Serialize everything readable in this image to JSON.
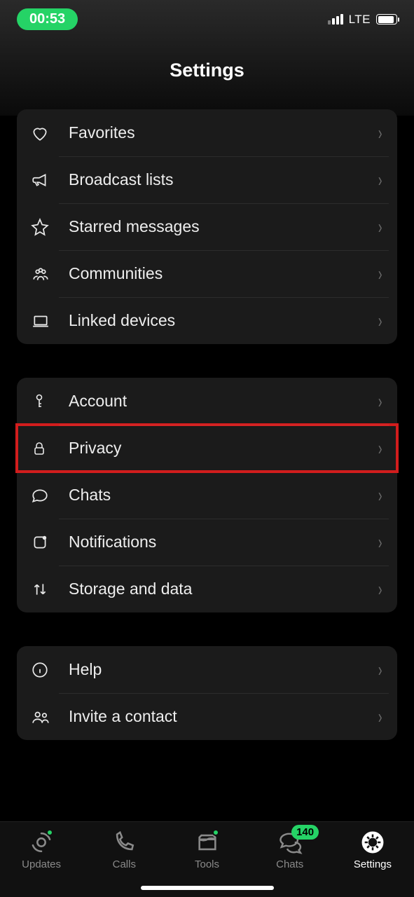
{
  "status": {
    "time": "00:53",
    "network": "LTE"
  },
  "page_title": "Settings",
  "groups": [
    {
      "rows": [
        {
          "key": "favorites",
          "label": "Favorites"
        },
        {
          "key": "broadcast",
          "label": "Broadcast lists"
        },
        {
          "key": "starred",
          "label": "Starred messages"
        },
        {
          "key": "communities",
          "label": "Communities"
        },
        {
          "key": "linked",
          "label": "Linked devices"
        }
      ]
    },
    {
      "rows": [
        {
          "key": "account",
          "label": "Account"
        },
        {
          "key": "privacy",
          "label": "Privacy",
          "highlight": true
        },
        {
          "key": "chats",
          "label": "Chats"
        },
        {
          "key": "notifications",
          "label": "Notifications"
        },
        {
          "key": "storage",
          "label": "Storage and data"
        }
      ]
    },
    {
      "rows": [
        {
          "key": "help",
          "label": "Help"
        },
        {
          "key": "invite",
          "label": "Invite a contact"
        }
      ]
    }
  ],
  "tabs": {
    "updates": {
      "label": "Updates",
      "dot": true
    },
    "calls": {
      "label": "Calls"
    },
    "tools": {
      "label": "Tools",
      "dot": true
    },
    "chats": {
      "label": "Chats",
      "badge": "140"
    },
    "settings": {
      "label": "Settings",
      "active": true
    }
  }
}
